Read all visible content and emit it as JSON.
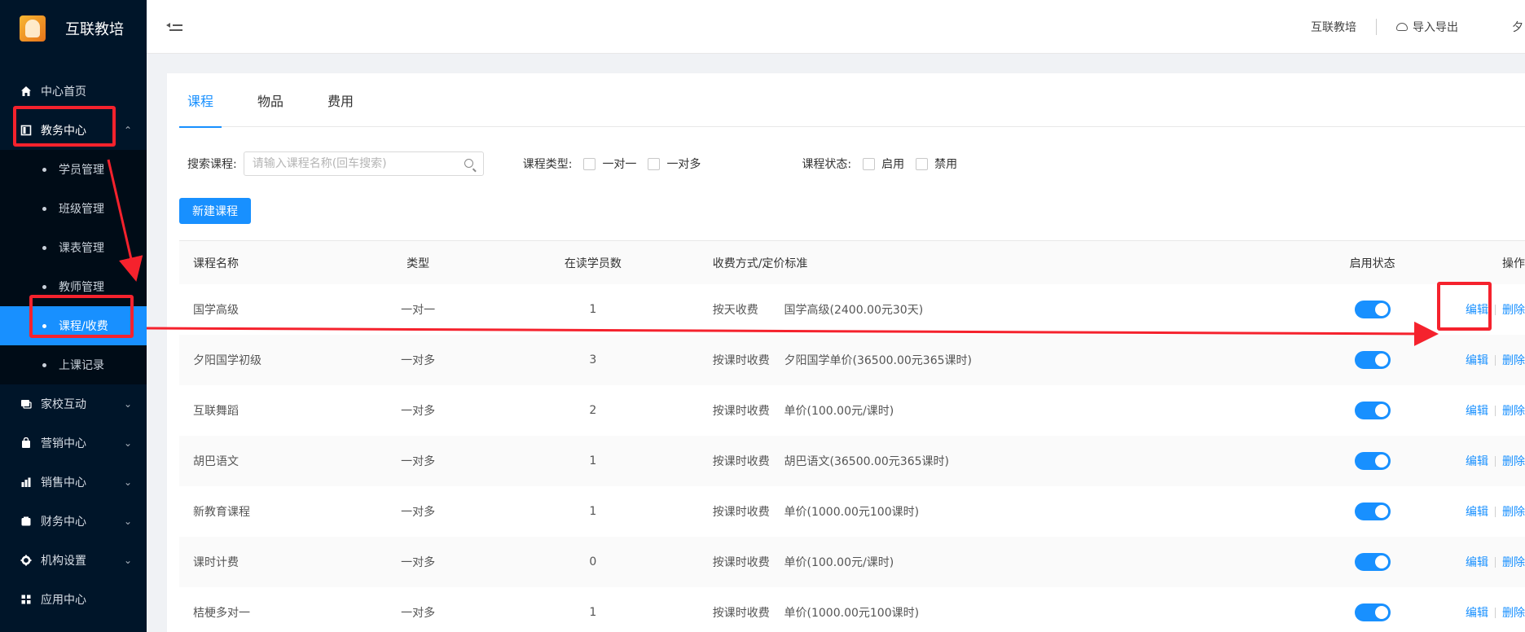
{
  "brand": {
    "title": "互联教培",
    "logo_icon": "brand-logo-icon"
  },
  "sidebar": {
    "items": [
      {
        "label": "中心首页",
        "icon": "home-icon"
      },
      {
        "label": "教务中心",
        "icon": "book-icon",
        "open": true
      },
      {
        "label": "家校互动",
        "icon": "chat-icon"
      },
      {
        "label": "营销中心",
        "icon": "bag-icon"
      },
      {
        "label": "销售中心",
        "icon": "chart-icon"
      },
      {
        "label": "财务中心",
        "icon": "wallet-icon"
      },
      {
        "label": "机构设置",
        "icon": "gear-icon"
      },
      {
        "label": "应用中心",
        "icon": "grid-icon"
      }
    ],
    "sub_items": [
      "学员管理",
      "班级管理",
      "课表管理",
      "教师管理",
      "课程/收费",
      "上课记录"
    ],
    "active_sub": "课程/收费"
  },
  "header": {
    "org_name": "互联教培",
    "import_export": "导入导出",
    "user_fragment": "夕"
  },
  "tabs": [
    "课程",
    "物品",
    "费用"
  ],
  "filters": {
    "search_label": "搜索课程:",
    "search_placeholder": "请输入课程名称(回车搜索)",
    "type_label": "课程类型:",
    "type_options": [
      "一对一",
      "一对多"
    ],
    "status_label": "课程状态:",
    "status_options": [
      "启用",
      "禁用"
    ]
  },
  "new_button": "新建课程",
  "table": {
    "headers": [
      "课程名称",
      "类型",
      "在读学员数",
      "收费方式/定价标准",
      "启用状态",
      "操作"
    ],
    "edit_label": "编辑",
    "delete_label": "删除",
    "rows": [
      {
        "name": "国学高级",
        "type": "一对一",
        "count": "1",
        "mode": "按天收费",
        "price": "国学高级(2400.00元30天)",
        "enabled": true
      },
      {
        "name": "夕阳国学初级",
        "type": "一对多",
        "count": "3",
        "mode": "按课时收费",
        "price": "夕阳国学单价(36500.00元365课时)",
        "enabled": true
      },
      {
        "name": "互联舞蹈",
        "type": "一对多",
        "count": "2",
        "mode": "按课时收费",
        "price": "单价(100.00元/课时)",
        "enabled": true
      },
      {
        "name": "胡巴语文",
        "type": "一对多",
        "count": "1",
        "mode": "按课时收费",
        "price": "胡巴语文(36500.00元365课时)",
        "enabled": true
      },
      {
        "name": "新教育课程",
        "type": "一对多",
        "count": "1",
        "mode": "按课时收费",
        "price": "单价(1000.00元100课时)",
        "enabled": true
      },
      {
        "name": "课时计费",
        "type": "一对多",
        "count": "0",
        "mode": "按课时收费",
        "price": "单价(100.00元/课时)",
        "enabled": true
      },
      {
        "name": "桔梗多对一",
        "type": "一对多",
        "count": "1",
        "mode": "按课时收费",
        "price": "单价(1000.00元100课时)",
        "enabled": true
      }
    ]
  },
  "annotation_color": "#f5222d",
  "accent_color": "#1890ff"
}
